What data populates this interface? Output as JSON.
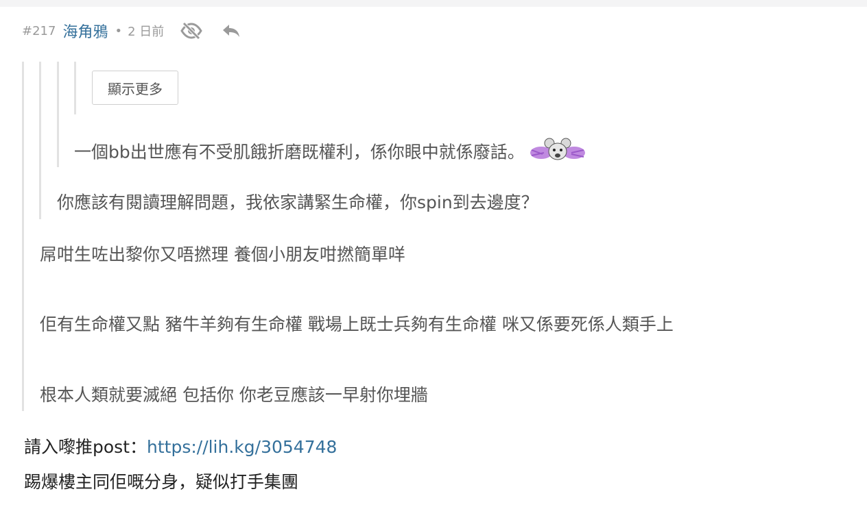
{
  "post": {
    "number": "#217",
    "username": "海角鴉",
    "separator": "•",
    "time": "2 日前",
    "icons": {
      "hide": "eye-slash-icon",
      "reply": "reply-icon"
    }
  },
  "quote": {
    "show_more_label": "顯示更多",
    "level3_text": "一個bb出世應有不受肌餓折磨既權利，係你眼中就係廢話。",
    "level3_sticker": "mouse-sticker-icon",
    "level2_text": "你應該有閱讀理解問題，我依家講緊生命權，你spin到去邊度？",
    "level1_lines": [
      "屌咁生咗出黎你又唔撚理 養個小朋友咁撚簡單咩",
      "佢有生命權又點 豬牛羊夠有生命權 戰場上既士兵夠有生命權 咪又係要死係人類手上",
      "根本人類就要滅絕 包括你 你老豆應該一早射你埋牆"
    ]
  },
  "body": {
    "line1_prefix": "請入嚟推post：",
    "line1_link": "https://lih.kg/3054748",
    "line2": "踢爆樓主同佢嘅分身，疑似打手集團"
  },
  "colors": {
    "link": "#34709b",
    "meta": "#9a9a9a",
    "quote_border": "#e2e2e2"
  }
}
